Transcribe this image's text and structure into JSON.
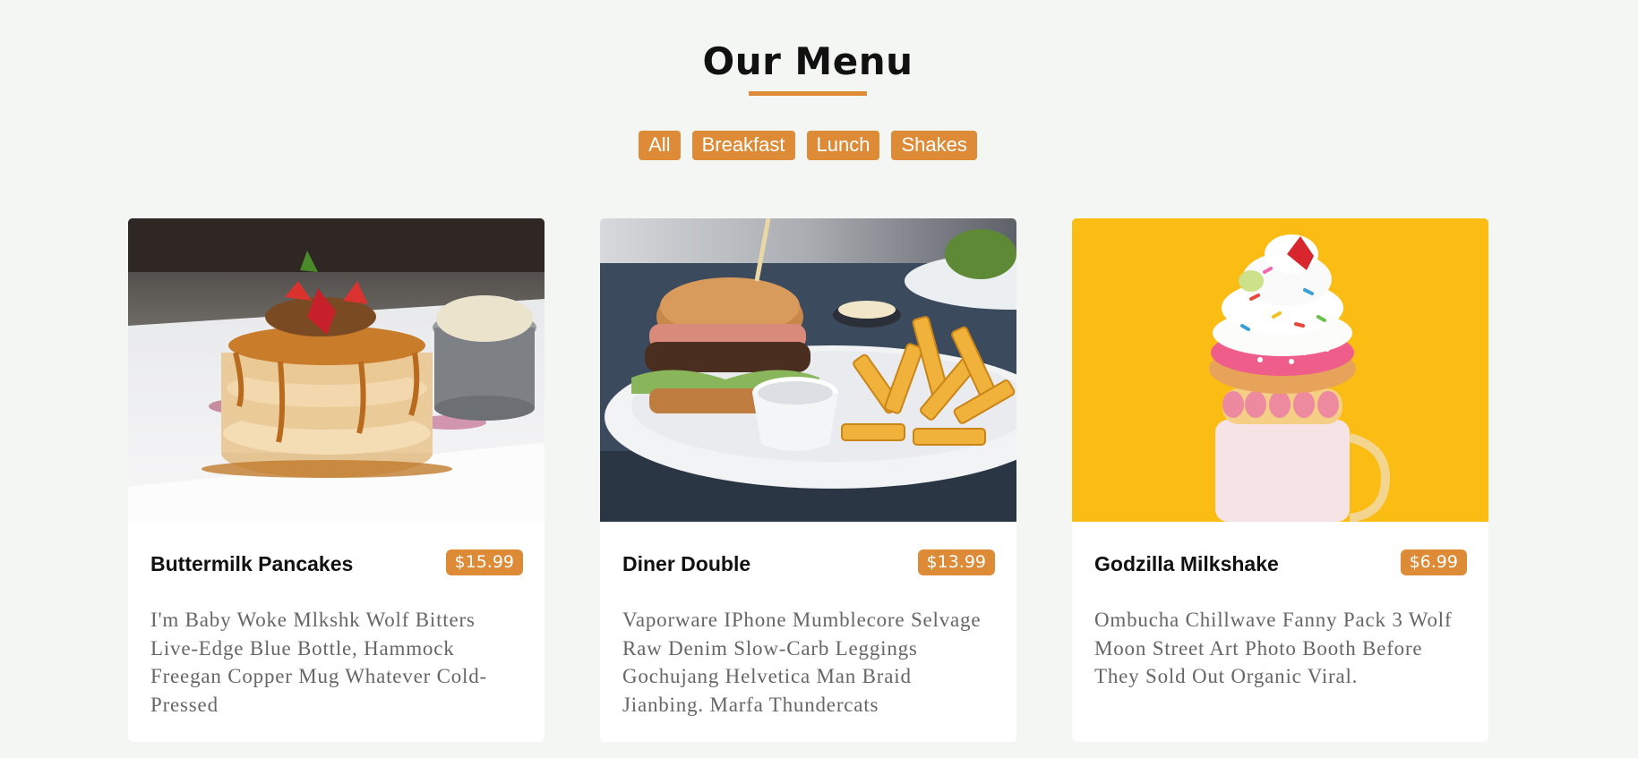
{
  "header": {
    "title": "Our Menu"
  },
  "filters": [
    {
      "label": "All"
    },
    {
      "label": "Breakfast"
    },
    {
      "label": "Lunch"
    },
    {
      "label": "Shakes"
    }
  ],
  "items": [
    {
      "name": "Buttermilk Pancakes",
      "price": "$15.99",
      "description": "I'm Baby Woke Mlkshk Wolf Bitters Live-Edge Blue Bottle, Hammock Freegan Copper Mug Whatever Cold-Pressed",
      "image": "pancake-stack-photo"
    },
    {
      "name": "Diner Double",
      "price": "$13.99",
      "description": "Vaporware IPhone Mumblecore Selvage Raw Denim Slow-Carb Leggings Gochujang Helvetica Man Braid Jianbing. Marfa Thundercats",
      "image": "burger-and-fries-photo"
    },
    {
      "name": "Godzilla Milkshake",
      "price": "$6.99",
      "description": "Ombucha Chillwave Fanny Pack 3 Wolf Moon Street Art Photo Booth Before They Sold Out Organic Viral.",
      "image": "milkshake-with-donut-photo"
    }
  ],
  "colors": {
    "accent": "#de8b37",
    "background": "#f4f6f3",
    "card": "#ffffff",
    "milkshake_backdrop": "#fbbd14"
  }
}
